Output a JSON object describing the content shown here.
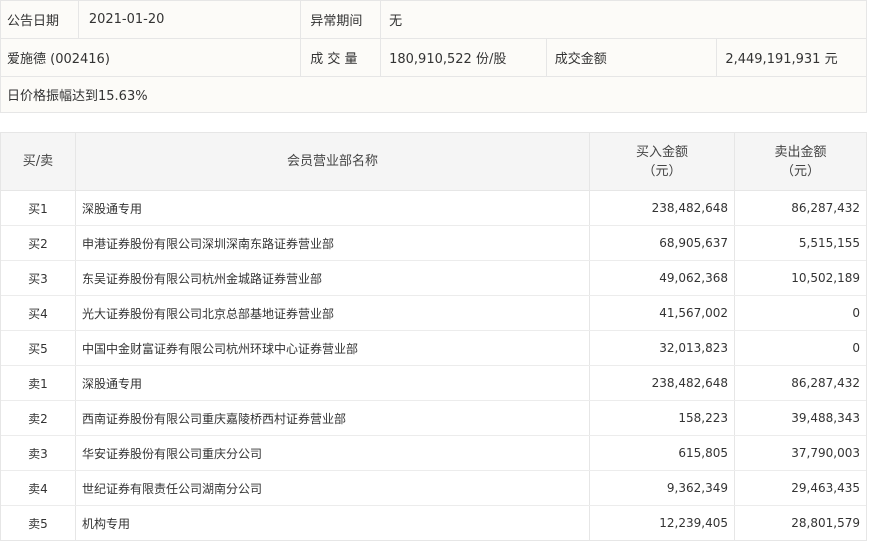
{
  "info": {
    "announce_date_label": "公告日期",
    "announce_date_value": "2021-01-20",
    "abnormal_period_label": "异常期间",
    "abnormal_period_value": "无",
    "stock_name": "爱施德 (002416)",
    "volume_label": "成 交 量",
    "volume_value": "180,910,522 份/股",
    "turnover_label": "成交金额",
    "turnover_value": "2,449,191,931 元",
    "reason": "日价格振幅达到15.63%"
  },
  "table": {
    "headers": {
      "side": "买/卖",
      "branch": "会员营业部名称",
      "buy_amount": "买入金额",
      "buy_unit": "（元）",
      "sell_amount": "卖出金额",
      "sell_unit": "（元）"
    },
    "rows": [
      {
        "side": "买1",
        "branch": "深股通专用",
        "buy": "238,482,648",
        "sell": "86,287,432"
      },
      {
        "side": "买2",
        "branch": "申港证券股份有限公司深圳深南东路证券营业部",
        "buy": "68,905,637",
        "sell": "5,515,155"
      },
      {
        "side": "买3",
        "branch": "东吴证券股份有限公司杭州金城路证券营业部",
        "buy": "49,062,368",
        "sell": "10,502,189"
      },
      {
        "side": "买4",
        "branch": "光大证券股份有限公司北京总部基地证券营业部",
        "buy": "41,567,002",
        "sell": "0"
      },
      {
        "side": "买5",
        "branch": "中国中金财富证券有限公司杭州环球中心证券营业部",
        "buy": "32,013,823",
        "sell": "0"
      },
      {
        "side": "卖1",
        "branch": "深股通专用",
        "buy": "238,482,648",
        "sell": "86,287,432"
      },
      {
        "side": "卖2",
        "branch": "西南证券股份有限公司重庆嘉陵桥西村证券营业部",
        "buy": "158,223",
        "sell": "39,488,343"
      },
      {
        "side": "卖3",
        "branch": "华安证券股份有限公司重庆分公司",
        "buy": "615,805",
        "sell": "37,790,003"
      },
      {
        "side": "卖4",
        "branch": "世纪证券有限责任公司湖南分公司",
        "buy": "9,362,349",
        "sell": "29,463,435"
      },
      {
        "side": "卖5",
        "branch": "机构专用",
        "buy": "12,239,405",
        "sell": "28,801,579"
      }
    ]
  }
}
